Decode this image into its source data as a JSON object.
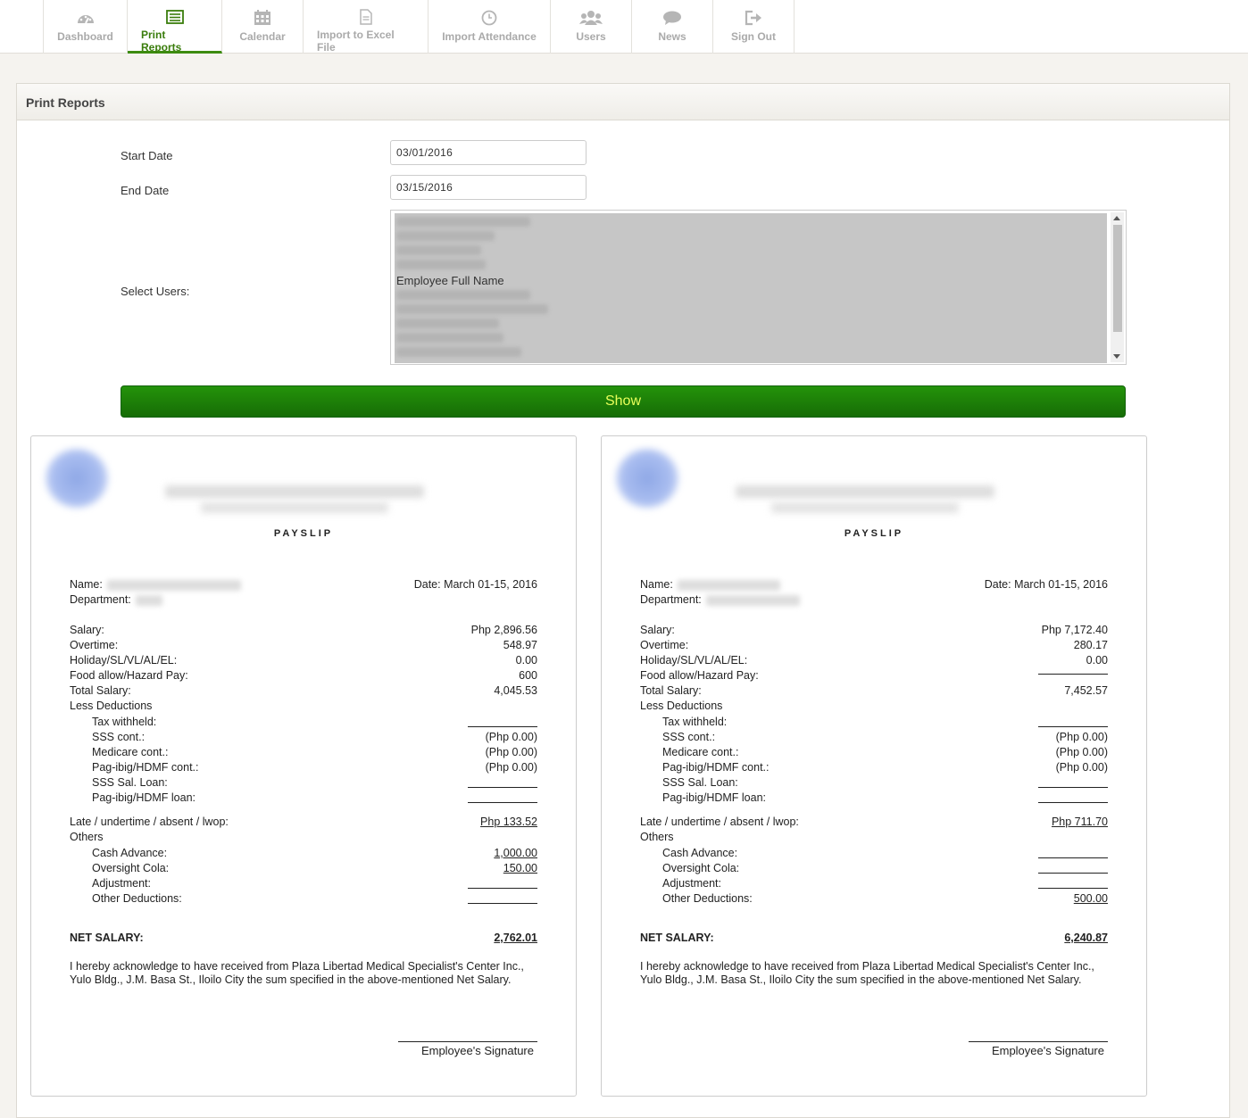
{
  "nav": {
    "tabs": [
      {
        "label": "Dashboard",
        "icon": "dashboard-icon"
      },
      {
        "label": "Print Reports",
        "icon": "list-icon",
        "active": true
      },
      {
        "label": "Calendar",
        "icon": "calendar-icon"
      },
      {
        "label": "Import to Excel File",
        "icon": "file-icon"
      },
      {
        "label": "Import Attendance",
        "icon": "clock-icon"
      },
      {
        "label": "Users",
        "icon": "users-icon"
      },
      {
        "label": "News",
        "icon": "comment-icon"
      },
      {
        "label": "Sign Out",
        "icon": "sign-out-icon"
      }
    ],
    "active_color": "#3a7d0c"
  },
  "panel": {
    "title": "Print Reports",
    "start_label": "Start Date",
    "start_value": "03/01/2016",
    "end_label": "End Date",
    "end_value": "03/15/2016",
    "users_label": "Select Users:",
    "users_visible_option": "Employee Full Name",
    "show_button": "Show",
    "show_color": "#1e8a09"
  },
  "payslips": [
    {
      "title": "PAYSLIP",
      "name_label": "Name:",
      "department_label": "Department:",
      "date": "Date: March 01-15, 2016",
      "salary_label": "Salary:",
      "salary": "Php 2,896.56",
      "overtime_label": "Overtime:",
      "overtime": "548.97",
      "holiday_label": "Holiday/SL/VL/AL/EL:",
      "holiday": "0.00",
      "food_label": "Food allow/Hazard Pay:",
      "food": "600",
      "total_label": "Total Salary:",
      "total": "4,045.53",
      "less_label": "Less Deductions",
      "tax_label": "Tax withheld:",
      "tax": "",
      "sss_label": "SSS cont.:",
      "sss": "(Php 0.00)",
      "medicare_label": "Medicare cont.:",
      "medicare": "(Php 0.00)",
      "pagibig_label": "Pag-ibig/HDMF cont.:",
      "pagibig": "(Php 0.00)",
      "sss_loan_label": "SSS Sal. Loan:",
      "sss_loan": "",
      "pagibig_loan_label": "Pag-ibig/HDMF loan:",
      "pagibig_loan": "",
      "late_label": "Late / undertime / absent / lwop:",
      "late": "Php 133.52",
      "others_label": "Others",
      "cash_label": "Cash Advance:",
      "cash": "1,000.00",
      "cola_label": "Oversight Cola:",
      "cola": "150.00",
      "adjust_label": "Adjustment:",
      "adjust": "",
      "other_ded_label": "Other Deductions:",
      "other_ded": "",
      "net_label": "NET SALARY:",
      "net": "2,762.01",
      "ack": "I hereby acknowledge to have received from Plaza Libertad Medical Specialist's Center Inc., Yulo Bldg., J.M. Basa St., Iloilo City the sum specified in the above-mentioned Net Salary.",
      "signature": "Employee's Signature"
    },
    {
      "title": "PAYSLIP",
      "name_label": "Name:",
      "department_label": "Department:",
      "date": "Date: March 01-15, 2016",
      "salary_label": "Salary:",
      "salary": "Php 7,172.40",
      "overtime_label": "Overtime:",
      "overtime": "280.17",
      "holiday_label": "Holiday/SL/VL/AL/EL:",
      "holiday": "0.00",
      "food_label": "Food allow/Hazard Pay:",
      "food": "",
      "total_label": "Total Salary:",
      "total": "7,452.57",
      "less_label": "Less Deductions",
      "tax_label": "Tax withheld:",
      "tax": "",
      "sss_label": "SSS cont.:",
      "sss": "(Php 0.00)",
      "medicare_label": "Medicare cont.:",
      "medicare": "(Php 0.00)",
      "pagibig_label": "Pag-ibig/HDMF cont.:",
      "pagibig": "(Php 0.00)",
      "sss_loan_label": "SSS Sal. Loan:",
      "sss_loan": "",
      "pagibig_loan_label": "Pag-ibig/HDMF loan:",
      "pagibig_loan": "",
      "late_label": "Late / undertime / absent / lwop:",
      "late": "Php 711.70",
      "others_label": "Others",
      "cash_label": "Cash Advance:",
      "cash": "",
      "cola_label": "Oversight Cola:",
      "cola": "",
      "adjust_label": "Adjustment:",
      "adjust": "",
      "other_ded_label": "Other Deductions:",
      "other_ded": "500.00",
      "net_label": "NET SALARY:",
      "net": "6,240.87",
      "ack": "I hereby acknowledge to have received from Plaza Libertad Medical Specialist's Center Inc., Yulo Bldg., J.M. Basa St., Iloilo City the sum specified in the above-mentioned Net Salary.",
      "signature": "Employee's Signature"
    }
  ]
}
